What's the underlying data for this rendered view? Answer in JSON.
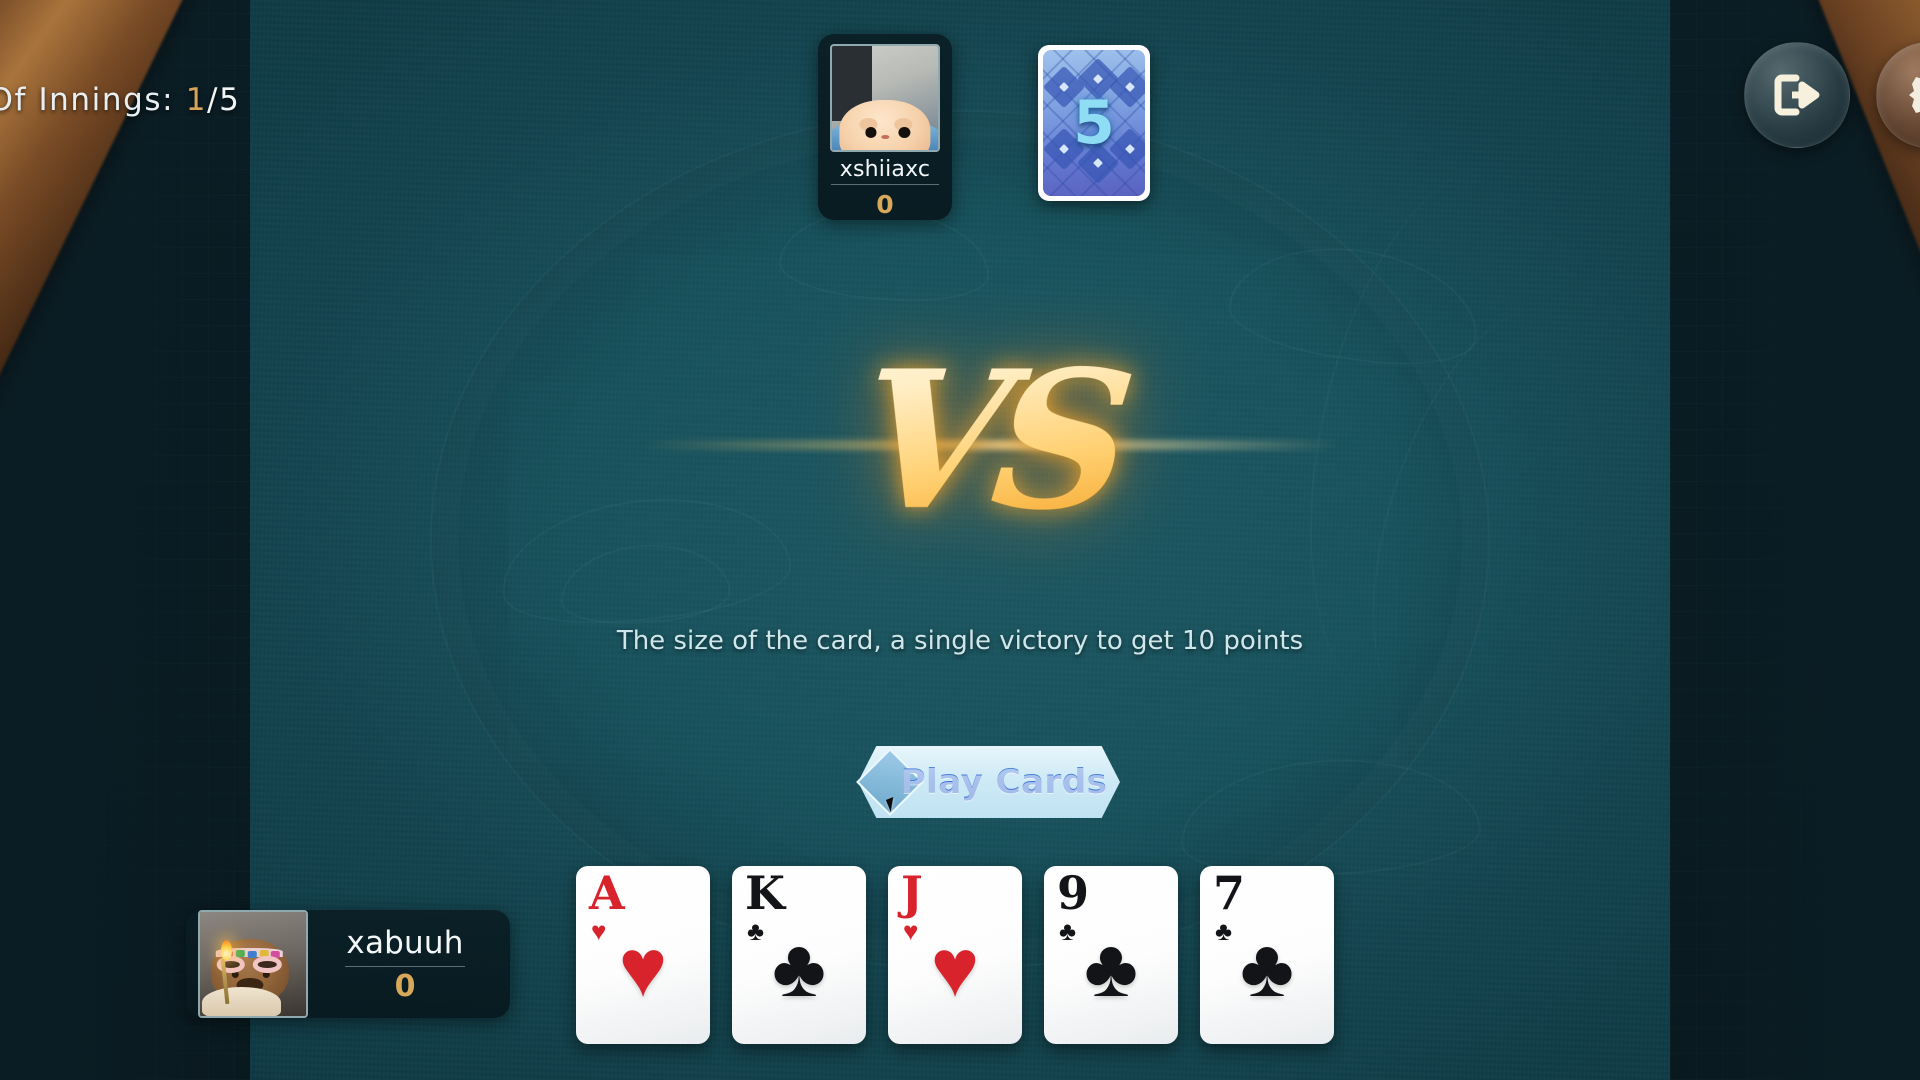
{
  "hud": {
    "innings_label": "er Of Innings:",
    "innings_current": "1",
    "innings_sep": "/",
    "innings_total": "5"
  },
  "buttons": {
    "exit": "exit-icon",
    "settings": "gear-icon"
  },
  "players": {
    "top": {
      "name": "xshiiaxc",
      "score": "0",
      "avatar": "hamster-avatar"
    },
    "bottom": {
      "name": "xabuuh",
      "score": "0",
      "avatar": "teddy-bear-birthday-avatar"
    }
  },
  "deck": {
    "count": "5"
  },
  "vs": {
    "text": "VS"
  },
  "rules": {
    "text": "The size of the card, a single victory to get 10 points"
  },
  "actions": {
    "play_cards": "Play Cards"
  },
  "hand": {
    "cards": [
      {
        "rank": "A",
        "suit": "♥",
        "color": "red"
      },
      {
        "rank": "K",
        "suit": "♣",
        "color": "black"
      },
      {
        "rank": "J",
        "suit": "♥",
        "color": "red"
      },
      {
        "rank": "9",
        "suit": "♣",
        "color": "black"
      },
      {
        "rank": "7",
        "suit": "♣",
        "color": "black"
      }
    ]
  },
  "colors": {
    "felt": "#18525d",
    "gold": "#d8a85a",
    "panel": "#0a1d24",
    "play_button": "#cfeaf6",
    "card_red": "#d8222c",
    "card_black": "#121417",
    "deck_blue": "#6276cf"
  }
}
